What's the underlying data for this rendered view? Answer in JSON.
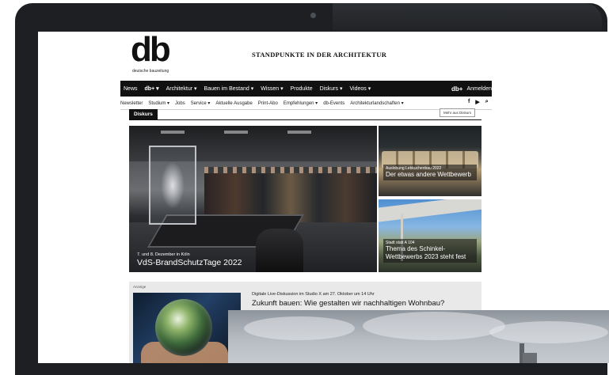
{
  "site": {
    "logo_text": "db",
    "logo_subtext": "deutsche bauzeitung",
    "tagline": "STANDPUNKTE IN DER ARCHITEKTUR"
  },
  "nav": {
    "items": [
      "News",
      "db+ ▾",
      "Architektur ▾",
      "Bauen im Bestand ▾",
      "Wissen ▾",
      "Produkte",
      "Diskurs ▾",
      "Videos ▾"
    ],
    "mini_logo": "db+",
    "login": "Anmelden"
  },
  "subnav": {
    "items": [
      "Newsletter",
      "Studium ▾",
      "Jobs",
      "Service ▾",
      "Aktuelle Ausgabe",
      "Print-Abo",
      "Empfehlungen ▾",
      "db-Events",
      "Architekturlandschaften ▾"
    ],
    "icons": [
      "facebook-icon",
      "youtube-icon",
      "search-icon"
    ],
    "icon_glyphs": [
      "f",
      "▶",
      "⌕"
    ]
  },
  "section": {
    "tab": "Diskurs",
    "more": "Mehr aus Diskurs"
  },
  "main_feature": {
    "kicker": "7. und 8. Dezember in Köln",
    "title": "VdS-BrandSchutzTage 2022"
  },
  "side_features": [
    {
      "kicker": "Auslobung Lebkuchenbau 2022",
      "title": "Der etwas andere Wettbewerb"
    },
    {
      "kicker": "Stadt statt A 104",
      "title": "Thema des Schinkel-Wettbewerbs 2023 steht fest"
    }
  ],
  "ad": {
    "label": "Anzeige",
    "kicker": "Digitale Live-Diskussion im Studio X am 27. Oktober um 14 Uhr",
    "title": "Zukunft bauen: Wie gestalten wir nachhaltigen Wohnbau?"
  },
  "colors": {
    "nav_bg": "#111111",
    "laptop_frame": "#1d1f22",
    "ad_bg": "#e9e9e9"
  }
}
